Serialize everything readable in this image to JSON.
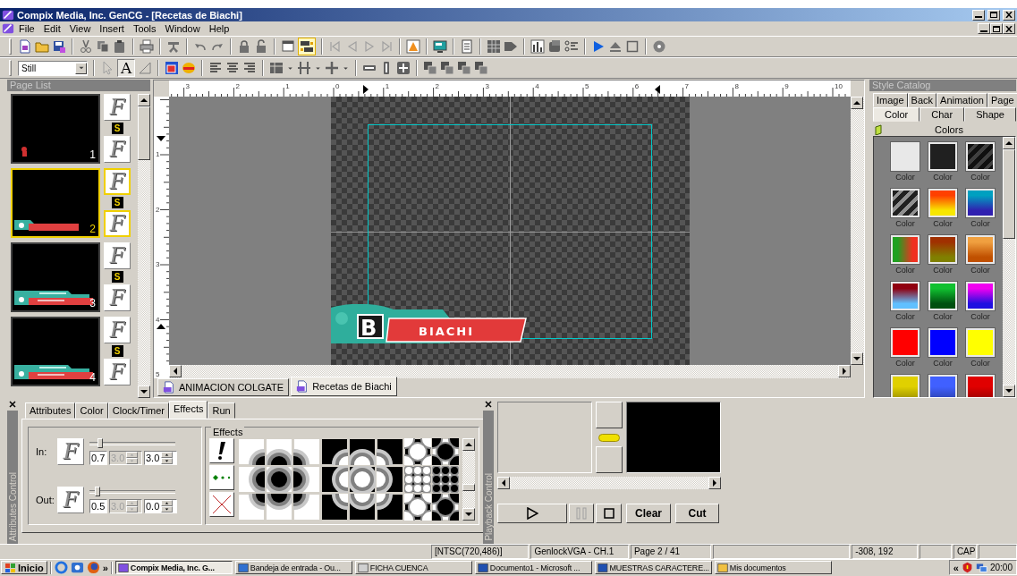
{
  "window": {
    "title": "Compix Media, Inc. GenCG - [Recetas de Biachi]"
  },
  "menu": [
    "File",
    "Edit",
    "View",
    "Insert",
    "Tools",
    "Window",
    "Help"
  ],
  "main_toolbar": {
    "toggle_on": true,
    "nav_disabled": true
  },
  "format_toolbar": {
    "style_select": "Still",
    "text_tool": {
      "label": "A",
      "selected": true
    }
  },
  "page_list": {
    "title": "Page List",
    "pages": [
      {
        "number": "1",
        "selected": false,
        "in": "F",
        "badge": "S",
        "out": "F",
        "kind": "logo"
      },
      {
        "number": "2",
        "selected": true,
        "in": "F",
        "badge": "S",
        "out": "F",
        "kind": "bar"
      },
      {
        "number": "3",
        "selected": false,
        "in": "F",
        "badge": "S",
        "out": "F",
        "kind": "double_bar"
      },
      {
        "number": "4",
        "selected": false,
        "in": "F",
        "badge": "S",
        "out": "F",
        "kind": "double_bar"
      }
    ]
  },
  "rulers": {
    "horizontal": [
      "3",
      "2",
      "1",
      "0",
      "1",
      "2",
      "3",
      "4",
      "5",
      "6",
      "7",
      "8",
      "9",
      "10"
    ],
    "vertical": [
      "1",
      "2",
      "3",
      "4",
      "5"
    ]
  },
  "canvas": {
    "logo": "B",
    "banner_text": "BIACHI"
  },
  "document_tabs": [
    {
      "label": "ANIMACION COLGATE",
      "selected": false
    },
    {
      "label": "Recetas de Biachi",
      "selected": true
    }
  ],
  "style_catalog": {
    "title": "Style Catalog",
    "tabs_top": [
      {
        "label": "Image",
        "selected": false
      },
      {
        "label": "Back",
        "selected": false
      },
      {
        "label": "Animation",
        "selected": false
      },
      {
        "label": "Page",
        "selected": false
      }
    ],
    "tabs_bottom": [
      {
        "label": "Color",
        "selected": true
      },
      {
        "label": "Char",
        "selected": false
      },
      {
        "label": "Shape",
        "selected": false
      }
    ],
    "folder": "Colors",
    "swatches": [
      {
        "label": "Color",
        "kind": "solid",
        "color": "#e8e8e8"
      },
      {
        "label": "Color",
        "kind": "solid",
        "color": "#202020"
      },
      {
        "label": "Color",
        "kind": "stripes",
        "stops": [
          {
            "color": "#101010"
          },
          {
            "color": "#404040"
          }
        ]
      },
      {
        "label": "Color",
        "kind": "stripes",
        "stops": [
          {
            "color": "#202020"
          },
          {
            "color": "#909090"
          }
        ]
      },
      {
        "label": "Color",
        "kind": "gradient",
        "stops": [
          {
            "color": "#ff4000"
          },
          {
            "color": "#f8e800"
          }
        ]
      },
      {
        "label": "Color",
        "kind": "gradient",
        "stops": [
          {
            "color": "#00a0c0"
          },
          {
            "color": "#3020b0"
          }
        ]
      },
      {
        "label": "Color",
        "kind": "hgradient",
        "stops": [
          {
            "color": "#20a020"
          },
          {
            "color": "#f03020"
          }
        ]
      },
      {
        "label": "Color",
        "kind": "gradient",
        "stops": [
          {
            "color": "#a03000"
          },
          {
            "color": "#808000"
          }
        ]
      },
      {
        "label": "Color",
        "kind": "gradient",
        "stops": [
          {
            "color": "#f0a040"
          },
          {
            "color": "#c05000"
          }
        ]
      },
      {
        "label": "Color",
        "kind": "gradient",
        "stops": [
          {
            "color": "#900010"
          },
          {
            "color": "#60c0ff"
          }
        ]
      },
      {
        "label": "Color",
        "kind": "gradient",
        "stops": [
          {
            "color": "#10c030"
          },
          {
            "color": "#005010"
          }
        ]
      },
      {
        "label": "Color",
        "kind": "gradient",
        "stops": [
          {
            "color": "#f000f0"
          },
          {
            "color": "#2010e0"
          }
        ]
      },
      {
        "label": "Color",
        "kind": "solid",
        "color": "#ff0000"
      },
      {
        "label": "Color",
        "kind": "solid",
        "color": "#0000ff"
      },
      {
        "label": "Color",
        "kind": "solid",
        "color": "#ffff00"
      },
      {
        "kind": "gradient",
        "stops": [
          {
            "color": "#e0d000"
          }
        ]
      },
      {
        "kind": "gradient",
        "stops": [
          {
            "color": "#4060ff"
          }
        ]
      },
      {
        "kind": "gradient",
        "stops": [
          {
            "color": "#e00000"
          }
        ]
      }
    ]
  },
  "attributes_control": {
    "title": "Attributes Control",
    "tabs": [
      {
        "label": "Attributes",
        "selected": false
      },
      {
        "label": "Color",
        "selected": false
      },
      {
        "label": "Clock/Timer",
        "selected": false
      },
      {
        "label": "Effects",
        "selected": true
      },
      {
        "label": "Run",
        "selected": false
      }
    ],
    "rows": [
      {
        "label": "In:",
        "effect": "F",
        "level": 0.1,
        "fields": [
          {
            "value": "0.7",
            "disabled": false,
            "spinner": false
          },
          {
            "value": "3.0",
            "disabled": true,
            "spinner": true
          },
          {
            "value": "3.0",
            "disabled": false,
            "spinner": true
          }
        ]
      },
      {
        "label": "Out:",
        "effect": "F",
        "level": 0.07,
        "fields": [
          {
            "value": "0.5",
            "disabled": false,
            "spinner": false
          },
          {
            "value": "3.0",
            "disabled": true,
            "spinner": true
          },
          {
            "value": "0.0",
            "disabled": false,
            "spinner": true
          }
        ]
      }
    ],
    "effects_title": "Effects"
  },
  "playback_control": {
    "title": "Playback Control",
    "pause_disabled": true,
    "buttons": [
      "Clear",
      "Cut"
    ]
  },
  "status_bar": [
    "[NTSC(720,486)]",
    "GenlockVGA - CH.1",
    "Page 2 / 41",
    "-308, 192",
    "CAP"
  ],
  "taskbar": {
    "start": "Inicio",
    "more": "»",
    "tasks": [
      {
        "label": "Compix Media, Inc. G...",
        "selected": true
      },
      {
        "label": "Bandeja de entrada - Ou...",
        "selected": false
      },
      {
        "label": "FICHA CUENCA",
        "selected": false
      },
      {
        "label": "Documento1 - Microsoft ...",
        "selected": false
      },
      {
        "label": "MUESTRAS CARACTERE...",
        "selected": false
      },
      {
        "label": "Mis documentos",
        "selected": false
      }
    ],
    "tray_more": "«",
    "clock": "20:00"
  }
}
